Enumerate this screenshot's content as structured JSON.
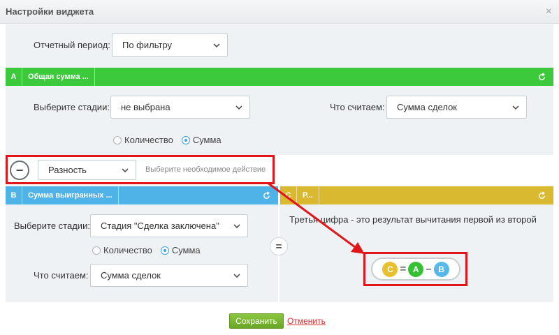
{
  "window": {
    "title": "Настройки виджета",
    "close_glyph": "×"
  },
  "report": {
    "label": "Отчетный период:",
    "value": "По фильтру"
  },
  "block_a": {
    "letter": "A",
    "name": "Общая сумма ...",
    "color": "#3cc93c",
    "stages_label": "Выберите стадии:",
    "stages_value": "не выбрана",
    "count_label": "Что считаем:",
    "count_value": "Сумма сделок",
    "radio_count": "Количество",
    "radio_sum": "Сумма",
    "selected": "sum"
  },
  "operation": {
    "value": "Разность",
    "hint": "Выберите необходимое действие",
    "minus_glyph": "−"
  },
  "block_b": {
    "letter": "B",
    "name": "Сумма выигранных ...",
    "color": "#4fb3e8",
    "stages_label": "Выберите стадии:",
    "stages_value": "Стадия \"Сделка заключена\"",
    "radio_count": "Количество",
    "radio_sum": "Сумма",
    "selected": "sum",
    "count_label": "Что считаем:",
    "count_value": "Сумма сделок"
  },
  "equals_glyph": "=",
  "block_c": {
    "letter": "C",
    "name": "Р...",
    "color": "#d9b92f",
    "description": "Третья цифра - это результат вычитания первой из второй",
    "formula": {
      "c": "C",
      "eq": "=",
      "a": "A",
      "op": "–",
      "b": "B"
    }
  },
  "footer": {
    "save": "Сохранить",
    "cancel": "Отменить"
  },
  "colors": {
    "highlight": "#e0161b",
    "c_badge": "#e8bf2e",
    "a_badge": "#34c234",
    "b_badge": "#57b8ea"
  }
}
